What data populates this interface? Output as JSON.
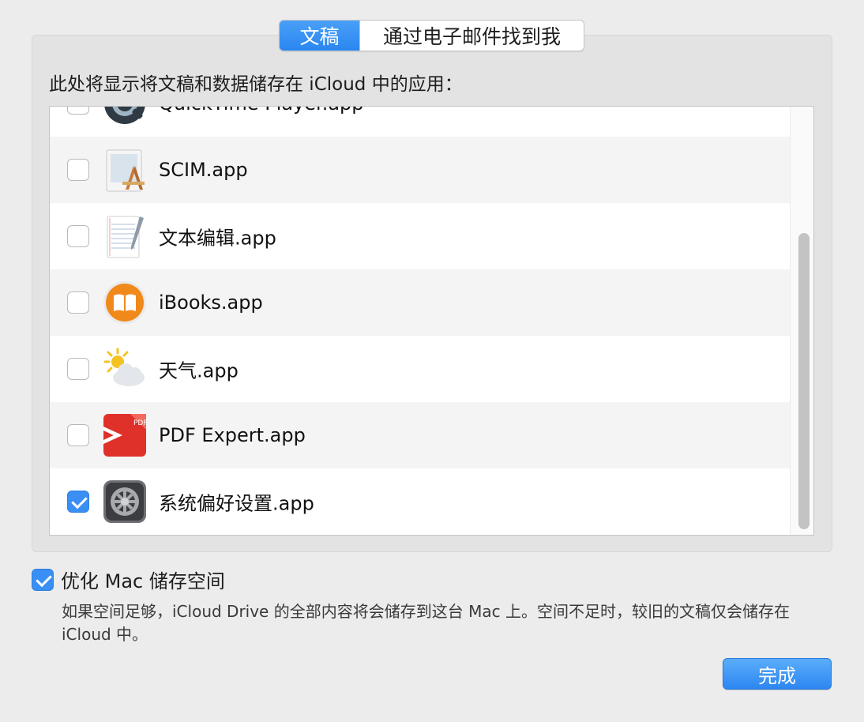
{
  "tabs": {
    "documents": "文稿",
    "email": "通过电子邮件找到我"
  },
  "description": "此处将显示将文稿和数据储存在 iCloud 中的应用：",
  "apps": [
    {
      "name": "QuickTime Player.app",
      "checked": false,
      "icon": "quicktime-icon"
    },
    {
      "name": "SCIM.app",
      "checked": false,
      "icon": "scim-icon"
    },
    {
      "name": "文本编辑.app",
      "checked": false,
      "icon": "textedit-icon"
    },
    {
      "name": "iBooks.app",
      "checked": false,
      "icon": "ibooks-icon"
    },
    {
      "name": "天气.app",
      "checked": false,
      "icon": "weather-icon"
    },
    {
      "name": "PDF Expert.app",
      "checked": false,
      "icon": "pdf-expert-icon"
    },
    {
      "name": "系统偏好设置.app",
      "checked": true,
      "icon": "system-preferences-icon"
    }
  ],
  "optimize": {
    "label": "优化 Mac 储存空间",
    "checked": true,
    "description": "如果空间足够，iCloud Drive 的全部内容将会储存到这台 Mac 上。空间不足时，较旧的文稿仅会储存在 iCloud 中。"
  },
  "done_label": "完成",
  "colors": {
    "accent": "#3a8ff5",
    "background": "#ececec",
    "row_alt": "#f4f4f4"
  }
}
